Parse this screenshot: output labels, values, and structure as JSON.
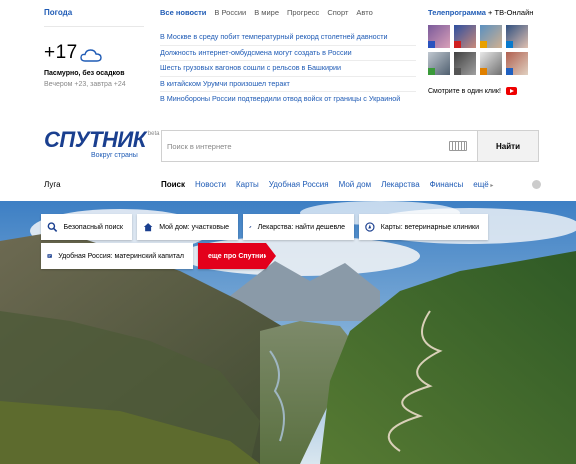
{
  "weather": {
    "title": "Погода",
    "temp": "+17",
    "condition": "Пасмурно, без осадков",
    "forecast": "Вечером +23, завтра +24",
    "icon": "cloud-icon"
  },
  "news": {
    "tabs": [
      "Все новости",
      "В России",
      "В мире",
      "Прогресс",
      "Спорт",
      "Авто"
    ],
    "items": [
      "В Москве в среду побит температурный рекорд столетней давности",
      "Должность интернет-омбудсмена могут создать в России",
      "Шесть грузовых вагонов сошли с рельсов в Башкирии",
      "В китайском Урумчи произошел теракт",
      "В Минобороны России подтвердили отвод войск от границы с Украиной"
    ]
  },
  "tele": {
    "title_bold": "Телепрограмма",
    "title_rest": " + ТВ-Онлайн",
    "watch": "Смотрите в один клик!"
  },
  "logo": {
    "word": "Спутник",
    "beta": "beta",
    "tagline": "Вокруг страны"
  },
  "search": {
    "placeholder": "Поиск в интернете",
    "button": "Найти"
  },
  "region": "Луга",
  "nav": [
    "Поиск",
    "Новости",
    "Карты",
    "Удобная Россия",
    "Мой дом",
    "Лекарства",
    "Финансы",
    "ещё"
  ],
  "chips": {
    "safe": "Безопасный поиск",
    "home": "Мой дом: участковые",
    "meds": "Лекарства: найти дешевле",
    "maps": "Карты: ветеринарные клиники",
    "russia": "Удобная Россия: материнский капитал",
    "more": "еще про Спутник"
  },
  "colors": {
    "link": "#1f5bb5",
    "brand": "#1a3f8f",
    "accent_red": "#e3001b"
  }
}
